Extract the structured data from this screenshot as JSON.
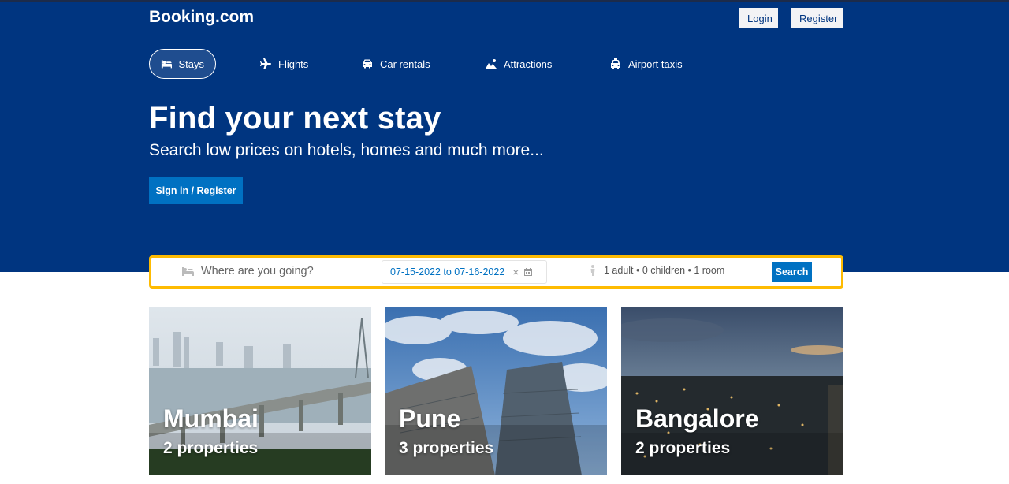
{
  "header": {
    "logo": "Booking.com",
    "login_label": "Login",
    "register_label": "Register"
  },
  "nav": {
    "items": [
      {
        "label": "Stays",
        "icon": "bed-icon",
        "active": true
      },
      {
        "label": "Flights",
        "icon": "plane-icon",
        "active": false
      },
      {
        "label": "Car rentals",
        "icon": "car-icon",
        "active": false
      },
      {
        "label": "Attractions",
        "icon": "attractions-icon",
        "active": false
      },
      {
        "label": "Airport taxis",
        "icon": "taxi-icon",
        "active": false
      }
    ]
  },
  "hero": {
    "title": "Find your next stay",
    "subtitle": "Search low prices on hotels, homes and much more...",
    "signin_label": "Sign in / Register"
  },
  "search": {
    "destination_placeholder": "Where are you going?",
    "dates": "07-15-2022 to 07-16-2022",
    "guests": "1 adult • 0 children • 1 room",
    "button_label": "Search"
  },
  "cities": [
    {
      "name": "Mumbai",
      "properties": "2 properties"
    },
    {
      "name": "Pune",
      "properties": "3 properties"
    },
    {
      "name": "Bangalore",
      "properties": "2 properties"
    }
  ],
  "colors": {
    "brand_blue": "#003580",
    "action_blue": "#0071c2",
    "search_border": "#febb02"
  }
}
